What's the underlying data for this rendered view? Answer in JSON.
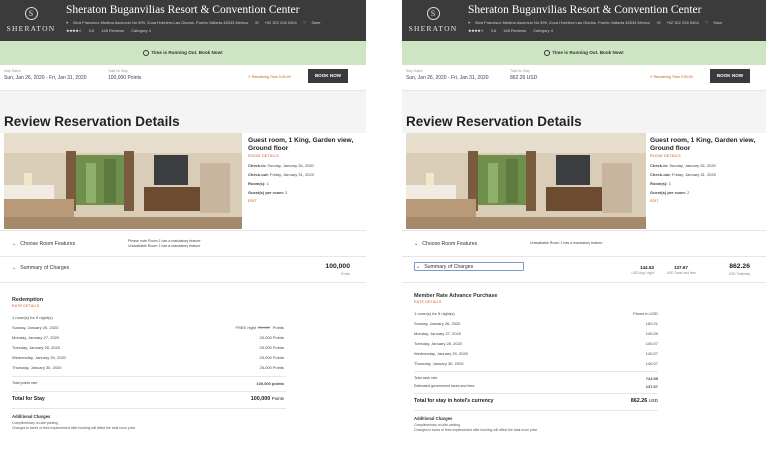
{
  "hotel": {
    "logo_word": "SHERATON",
    "name": "Sheraton Buganvilias Resort & Convention Center",
    "address": "Blvd Francisco Medina Ascencio No 999, Zona Hotelera Las Glorias, Puerto Vallarta 48333 Mexico",
    "phone": "+52 322 226 0404",
    "save": "Save",
    "stars": "★★★★☆",
    "rating": "3.8",
    "reviews": "165 Reviews",
    "category": "Category 4"
  },
  "banner": {
    "text": "Time is Running Out. Book Now!"
  },
  "left": {
    "stay_dates_label": "Stay Dates",
    "stay_dates": "Sun, Jan 26, 2020 - Fri, Jan 31, 2020",
    "total_label": "Total for Stay",
    "total": "100,000 Points",
    "remaining": "Remaining Time 0:00:00",
    "book": "BOOK NOW",
    "features_note_1": "Please note Room 1 has a mandatory feature",
    "features_note_2": "Unavailable Room 1 has a mandatory feature",
    "charges_amount": "100,000",
    "charges_unit": "Points",
    "detail_title": "Redemption",
    "detail_sub": "RATE DETAILS",
    "room_nights": "1 room(s) for 5 night(s)",
    "free_night": "FREE night",
    "struck": "25,000",
    "nights": [
      {
        "date": "Sunday, January 26, 2020",
        "value": "25,000 Points"
      },
      {
        "date": "Monday, January 27, 2020",
        "value": "25,000 Points"
      },
      {
        "date": "Tuesday, January 28, 2020",
        "value": "25,000 Points"
      },
      {
        "date": "Wednesday, January 29, 2020",
        "value": "25,000 Points"
      },
      {
        "date": "Thursday, January 30, 2020",
        "value": "25,000 Points"
      }
    ],
    "total_points_label": "Total points rate",
    "total_points_value": "100,000 points",
    "total_stay_label": "Total for Stay",
    "total_stay_value": "100,000",
    "total_stay_unit": "Points"
  },
  "right": {
    "stay_dates_label": "Stay Dates",
    "stay_dates": "Sun, Jan 26, 2020 - Fri, Jan 31, 2020",
    "total_label": "Total for Stay",
    "total": "862.26 USD",
    "remaining": "Remaining Time 0:00:00",
    "book": "BOOK NOW",
    "features_note": "Unavailable Room 1 has a mandatory feature",
    "amount_1": "144.53",
    "amount_1_sub": "USD Avg / night",
    "amount_2": "137.67",
    "amount_2_sub": "USD Taxes and fees",
    "amount_3": "862.26",
    "amount_3_sub": "USD Total/stay",
    "detail_title": "Member Rate Advance Purchase",
    "detail_sub": "RATE DETAILS",
    "room_nights": "1 room(s) for 5 night(s)",
    "prices_label": "Prices in USD",
    "nights": [
      {
        "date": "Sunday, January 26, 2020",
        "value": "160.21"
      },
      {
        "date": "Monday, January 27, 2020",
        "value": "140.00"
      },
      {
        "date": "Tuesday, January 28, 2020",
        "value": "140.07"
      },
      {
        "date": "Wednesday, January 29, 2020",
        "value": "140.07"
      },
      {
        "date": "Thursday, January 30, 2020",
        "value": "140.07"
      }
    ],
    "total_cash_label": "Total cash rate",
    "total_cash_value": "724.59",
    "taxes_label": "Estimated government taxes and fees",
    "taxes_value": "137.67",
    "total_stay_label": "Total for stay in hotel's currency",
    "total_stay_value": "862.26",
    "total_stay_unit": "USD"
  },
  "page_title": "Review Reservation Details",
  "room": {
    "title": "Guest room, 1 King, Garden view, Ground floor",
    "sub": "ROOM DETAILS",
    "checkin_label": "Check-in:",
    "checkin": "Sunday, January 26, 2020",
    "checkout_label": "Check-out:",
    "checkout": "Friday, January 31, 2020",
    "rooms_label": "Room(s):",
    "rooms": "1",
    "guests_label": "Guest(s) per room:",
    "guests": "2",
    "edit": "EDIT"
  },
  "sections": {
    "features": "Choose Room Features",
    "charges": "Summary of Charges"
  },
  "additional": {
    "title": "Additional Charges",
    "line_1": "Complimentary on-site parking",
    "line_2": "Changes in taxes or fees implemented after booking will affect the total room price."
  }
}
